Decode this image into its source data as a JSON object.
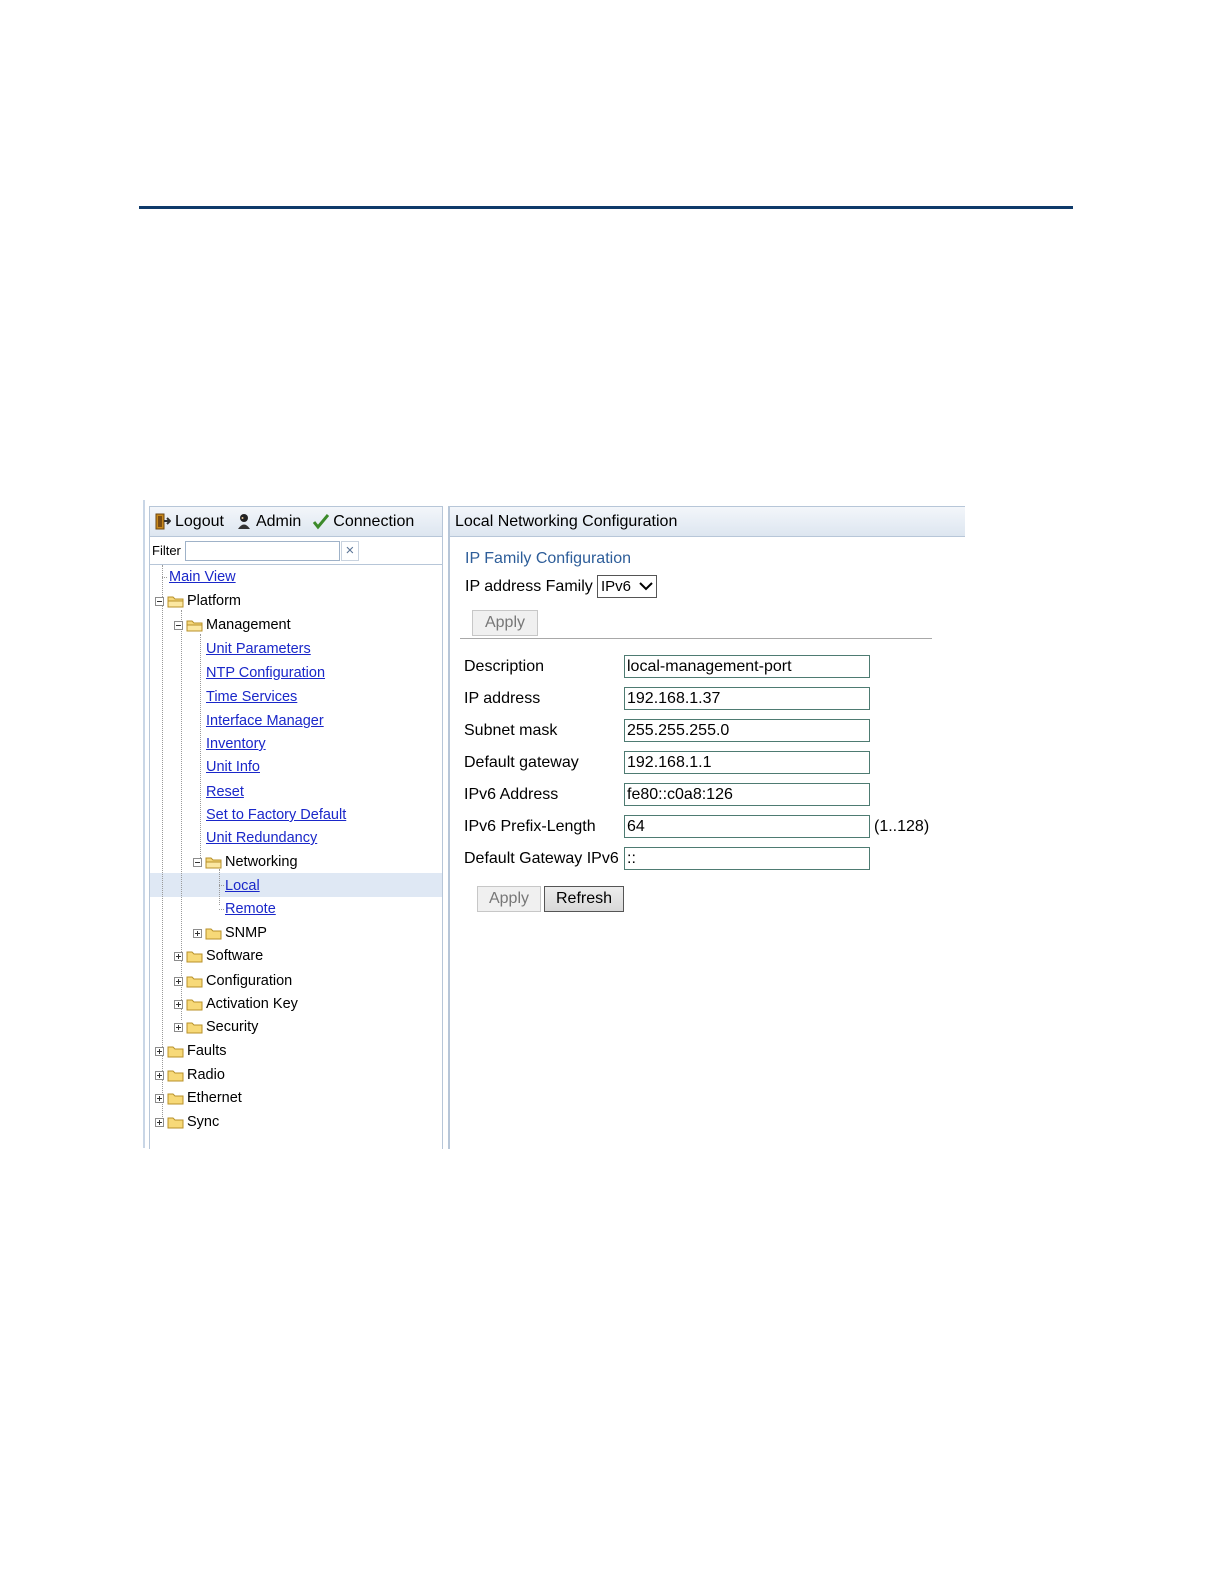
{
  "topbar": {
    "logout": "Logout",
    "admin": "Admin",
    "connection": "Connection"
  },
  "filter": {
    "label": "Filter",
    "value": "",
    "clear": "×"
  },
  "tree": {
    "main_view": "Main View",
    "platform": "Platform",
    "management": "Management",
    "unit_parameters": "Unit Parameters",
    "ntp_configuration": "NTP Configuration",
    "time_services": "Time Services",
    "interface_manager": "Interface Manager",
    "inventory": "Inventory",
    "unit_info": "Unit Info",
    "reset": "Reset",
    "set_to_factory_default": "Set to Factory Default",
    "unit_redundancy": "Unit Redundancy",
    "networking": "Networking",
    "local": "Local",
    "remote": "Remote",
    "snmp": "SNMP",
    "software": "Software",
    "configuration": "Configuration",
    "activation_key": "Activation Key",
    "security": "Security",
    "faults": "Faults",
    "radio": "Radio",
    "ethernet": "Ethernet",
    "sync": "Sync"
  },
  "panel": {
    "title": "Local Networking Configuration",
    "section_title": "IP Family Configuration",
    "family_label": "IP address Family",
    "family_value": "IPv6",
    "apply_label": "Apply",
    "refresh_label": "Refresh"
  },
  "fields": {
    "description": {
      "label": "Description",
      "value": "local-management-port"
    },
    "ip_address": {
      "label": "IP address",
      "value": "192.168.1.37"
    },
    "subnet_mask": {
      "label": "Subnet mask",
      "value": "255.255.255.0"
    },
    "default_gateway": {
      "label": "Default gateway",
      "value": "192.168.1.1"
    },
    "ipv6_address": {
      "label": "IPv6 Address",
      "value": "fe80::c0a8:126"
    },
    "ipv6_prefix_length": {
      "label": "IPv6 Prefix-Length",
      "value": "64",
      "range": "(1..128)"
    },
    "default_gateway_ipv6": {
      "label": "Default Gateway IPv6",
      "value": "::"
    }
  }
}
